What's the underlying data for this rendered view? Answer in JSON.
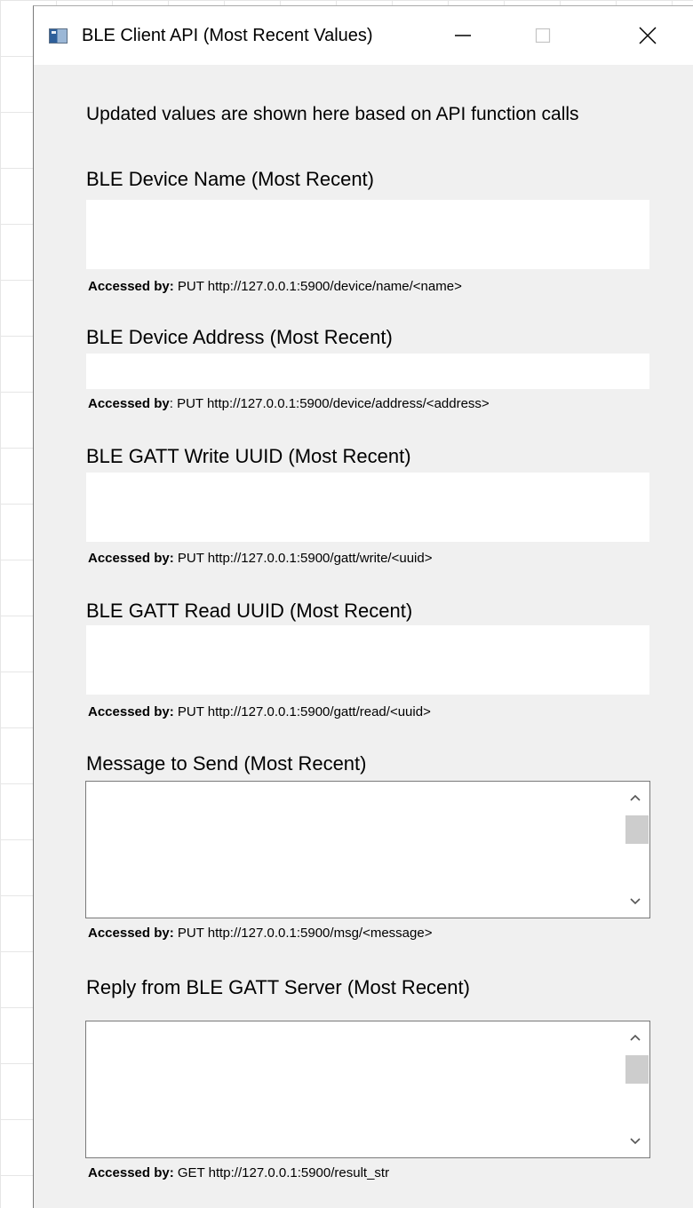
{
  "window": {
    "title": "BLE Client API (Most Recent Values)",
    "icons": {
      "app": "app-window-icon",
      "minimize": "minimize-icon",
      "maximize": "maximize-icon",
      "close": "close-icon"
    }
  },
  "intro": "Updated values are shown here based on API function calls",
  "fields": {
    "device_name": {
      "label": "BLE Device Name (Most Recent)",
      "value": "",
      "accessed_prefix": "Accessed by:",
      "accessed_endpoint": "PUT http://127.0.0.1:5900/device/name/<name>"
    },
    "device_address": {
      "label": "BLE Device Address (Most Recent)",
      "value": "",
      "accessed_prefix": "Accessed by",
      "accessed_endpoint": ": PUT http://127.0.0.1:5900/device/address/<address>"
    },
    "write_uuid": {
      "label": "BLE GATT Write UUID (Most Recent)",
      "value": "",
      "accessed_prefix": "Accessed by:",
      "accessed_endpoint": "PUT http://127.0.0.1:5900/gatt/write/<uuid>"
    },
    "read_uuid": {
      "label": "BLE GATT Read UUID (Most Recent)",
      "value": "",
      "accessed_prefix": "Accessed by:",
      "accessed_endpoint": "PUT http://127.0.0.1:5900/gatt/read/<uuid>"
    },
    "message": {
      "label": "Message to Send (Most Recent)",
      "value": "",
      "accessed_prefix": "Accessed by:",
      "accessed_endpoint": "PUT http://127.0.0.1:5900/msg/<message>"
    },
    "reply": {
      "label": "Reply from BLE GATT Server (Most Recent)",
      "value": "",
      "accessed_prefix": "Accessed by:",
      "accessed_endpoint": "GET http://127.0.0.1:5900/result_str"
    }
  },
  "colors": {
    "window_bg": "#f0f0f0",
    "titlebar_bg": "#ffffff",
    "field_bg": "#ffffff",
    "scroll_thumb": "#cdcdcd"
  }
}
